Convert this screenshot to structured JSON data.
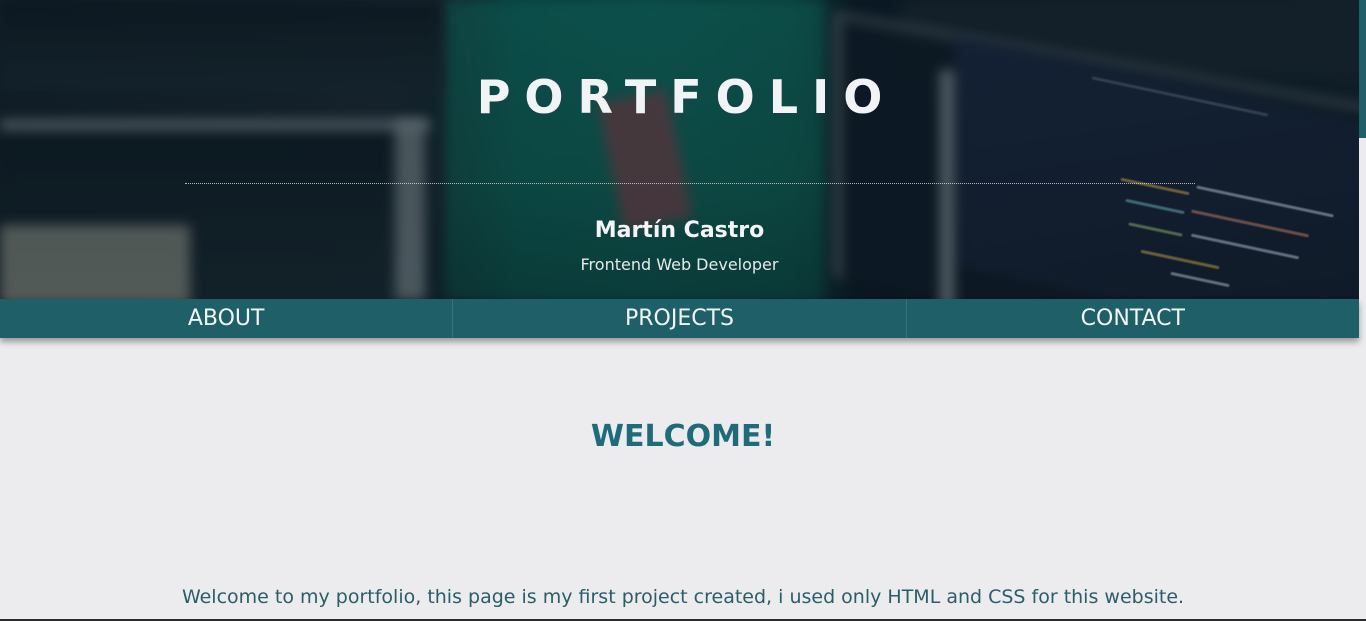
{
  "hero": {
    "title": "PORTFOLIO",
    "name": "Martín Castro",
    "role": "Frontend Web Developer"
  },
  "nav": {
    "items": [
      {
        "label": "ABOUT"
      },
      {
        "label": "PROJECTS"
      },
      {
        "label": "CONTACT"
      }
    ]
  },
  "main": {
    "heading": "WELCOME!",
    "intro": "Welcome to my portfolio, this page is my first project created, i used only HTML and CSS for this website."
  },
  "colors": {
    "nav_background": "#1f5f68",
    "heading_color": "#1f6b7a",
    "text_color": "#2a5d6a",
    "page_background": "#ececee"
  }
}
